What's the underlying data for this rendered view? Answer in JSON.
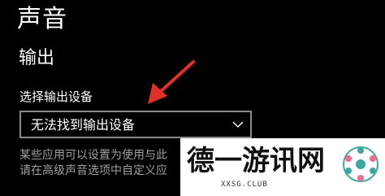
{
  "page": {
    "title": "声音"
  },
  "output_section": {
    "title": "输出",
    "device_label": "选择输出设备",
    "device_dropdown": {
      "selected": "无法找到输出设备",
      "icon": "chevron-down-icon"
    },
    "description_lines": [
      "某些应用可以设置为使用与此",
      "请在高级声音选项中自定义应"
    ]
  },
  "annotation": {
    "icon": "red-arrow-icon",
    "color": "#e0302a"
  },
  "watermark": {
    "text": "德一游讯网",
    "subtext": "XXSG.CLUB"
  },
  "colors": {
    "background": "#000000",
    "text": "#ffffff",
    "secondary_text": "#a0a0a0",
    "dropdown_border": "#8a8a8a"
  }
}
